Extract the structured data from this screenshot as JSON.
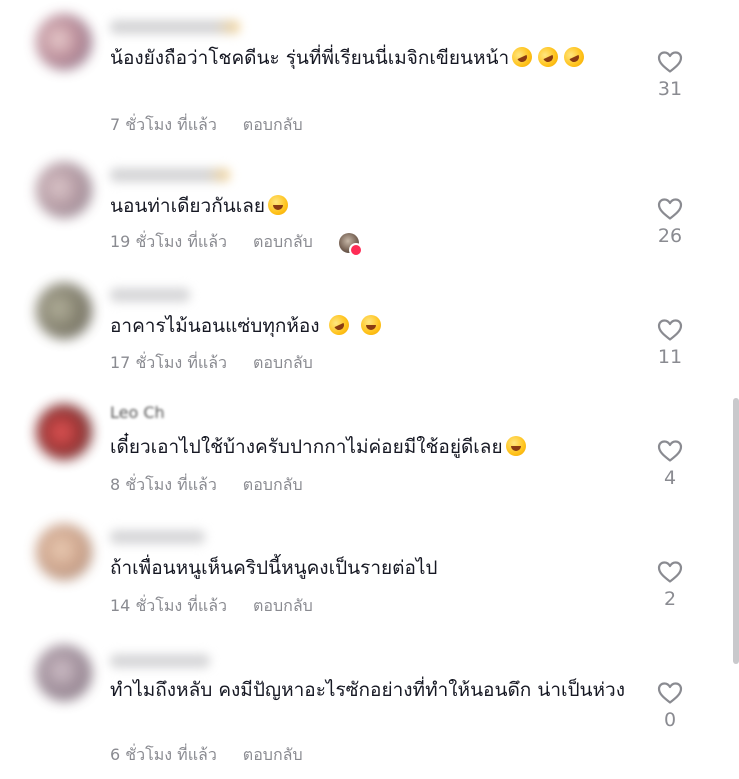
{
  "comments": [
    {
      "text": "น้องยังถือว่าโชคดีนะ รุ่นที่พี่เรียนนี่เมจิกเขียนหน้า",
      "time": "7 ชั่วโมง ที่แล้ว",
      "reply": "ตอบกลับ",
      "likes": "31",
      "emoji": [
        "rofl",
        "rofl",
        "rofl"
      ]
    },
    {
      "text": "นอนท่าเดียวกันเลย",
      "time": "19 ชั่วโมง ที่แล้ว",
      "reply": "ตอบกลับ",
      "likes": "26",
      "emoji": [
        "joy"
      ],
      "creator_liked": true
    },
    {
      "text": "อาคารไม้นอนแซ่บทุกห้อง",
      "time": "17 ชั่วโมง ที่แล้ว",
      "reply": "ตอบกลับ",
      "likes": "11",
      "emoji": [
        "rofl",
        "joy"
      ]
    },
    {
      "author": "Leo Ch",
      "text": "เดี๋ยวเอาไปใช้บ้างครับปากกาไม่ค่อยมีใช้อยู่ดีเลย",
      "time": "8 ชั่วโมง ที่แล้ว",
      "reply": "ตอบกลับ",
      "likes": "4",
      "emoji": [
        "joy"
      ]
    },
    {
      "text": "ถ้าเพื่อนหนูเห็นคริปนี้หนูคงเป็นรายต่อไป",
      "time": "14 ชั่วโมง ที่แล้ว",
      "reply": "ตอบกลับ",
      "likes": "2",
      "emoji": []
    },
    {
      "text": "ทำไมถึงหลับ คงมีปัญหาอะไรซักอย่างที่ทำให้นอนดึก น่าเป็นห่วง",
      "time": "6 ชั่วโมง ที่แล้ว",
      "reply": "ตอบกลับ",
      "likes": "0",
      "emoji": []
    }
  ],
  "colors": {
    "text": "#161823",
    "meta": "#8a8b91",
    "like_icon": "#8a8b91",
    "badge": "#fe2c55"
  },
  "icons": {
    "like": "heart-outline-icon",
    "creator_like": "creator-avatar-heart-icon"
  }
}
